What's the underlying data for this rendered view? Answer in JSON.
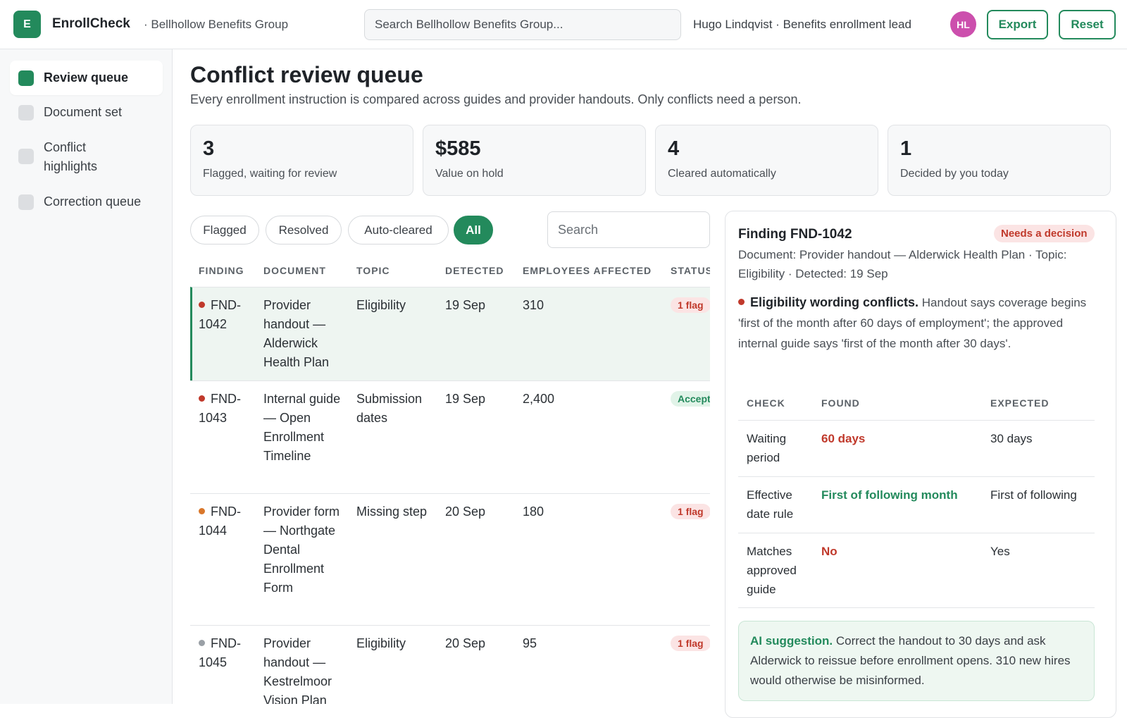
{
  "header": {
    "logo_letter": "E",
    "app_name": "EnrollCheck",
    "org_name": "· Bellhollow Benefits Group",
    "search_placeholder": "Search Bellhollow Benefits Group...",
    "user_label": "Hugo Lindqvist · Benefits enrollment lead",
    "avatar_initials": "HL",
    "export_label": "Export",
    "reset_label": "Reset"
  },
  "sidebar": {
    "items": [
      {
        "label": "Review queue",
        "active": true
      },
      {
        "label": "Document set",
        "active": false
      },
      {
        "label": "Conflict highlights",
        "active": false
      },
      {
        "label": "Correction queue",
        "active": false
      }
    ]
  },
  "main": {
    "title": "Conflict review queue",
    "subtitle": "Every enrollment instruction is compared across guides and provider handouts. Only conflicts need a person.",
    "kpis": [
      {
        "value": "3",
        "label": "Flagged, waiting for review"
      },
      {
        "value": "$585",
        "label": "Value on hold"
      },
      {
        "value": "4",
        "label": "Cleared automatically"
      },
      {
        "value": "1",
        "label": "Decided by you today"
      }
    ],
    "filters": [
      {
        "label": "Flagged",
        "active": false
      },
      {
        "label": "Resolved",
        "active": false
      },
      {
        "label": "Auto-cleared",
        "active": false
      },
      {
        "label": "All",
        "active": true
      }
    ],
    "search_placeholder": "Search"
  },
  "table": {
    "columns": [
      "FINDING",
      "DOCUMENT",
      "TOPIC",
      "DETECTED",
      "EMPLOYEES AFFECTED",
      "STATUS"
    ],
    "rows": [
      {
        "finding": "FND-1042",
        "dot_color": "#c0392b",
        "document": "Provider handout — Alderwick Health Plan",
        "topic": "Eligibility",
        "detected": "19 Sep",
        "affected": "310",
        "status": "1 flag",
        "status_kind": "flag"
      },
      {
        "finding": "FND-1043",
        "dot_color": "#c0392b",
        "document": "Internal guide — Open Enrollment Timeline",
        "topic": "Submission dates",
        "detected": "19 Sep",
        "affected": "2,400",
        "status": "Accept",
        "status_kind": "accept"
      },
      {
        "finding": "FND-1044",
        "dot_color": "#d9772b",
        "document": "Provider form — Northgate Dental Enrollment Form",
        "topic": "Missing step",
        "detected": "20 Sep",
        "affected": "180",
        "status": "1 flag",
        "status_kind": "flag"
      },
      {
        "finding": "FND-1045",
        "dot_color": "#9aa0a6",
        "document": "Provider handout — Kestrelmoor Vision Plan",
        "topic": "Eligibility",
        "detected": "20 Sep",
        "affected": "95",
        "status": "1 flag",
        "status_kind": "flag"
      }
    ]
  },
  "detail": {
    "title": "Finding FND-1042",
    "badge": "Needs a decision",
    "meta": "Document: Provider handout — Alderwick Health Plan · Topic: Eligibility · Detected: 19 Sep",
    "finding_heading": "Eligibility wording conflicts.",
    "finding_text": "Handout says coverage begins 'first of the month after 60 days of employment'; the approved internal guide says 'first of the month after 30 days'.",
    "check_columns": [
      "CHECK",
      "FOUND",
      "EXPECTED"
    ],
    "checks": [
      {
        "check": "Waiting period",
        "found": "60 days",
        "found_kind": "red",
        "expected": "30 days"
      },
      {
        "check": "Effective date rule",
        "found": "First of following month",
        "found_kind": "green",
        "expected": "First of following"
      },
      {
        "check": "Matches approved guide",
        "found": "No",
        "found_kind": "red",
        "expected": "Yes"
      }
    ],
    "ai_heading": "AI suggestion.",
    "ai_text": "Correct the handout to 30 days and ask Alderwick to reissue before enrollment opens. 310 new hires would otherwise be misinformed."
  }
}
